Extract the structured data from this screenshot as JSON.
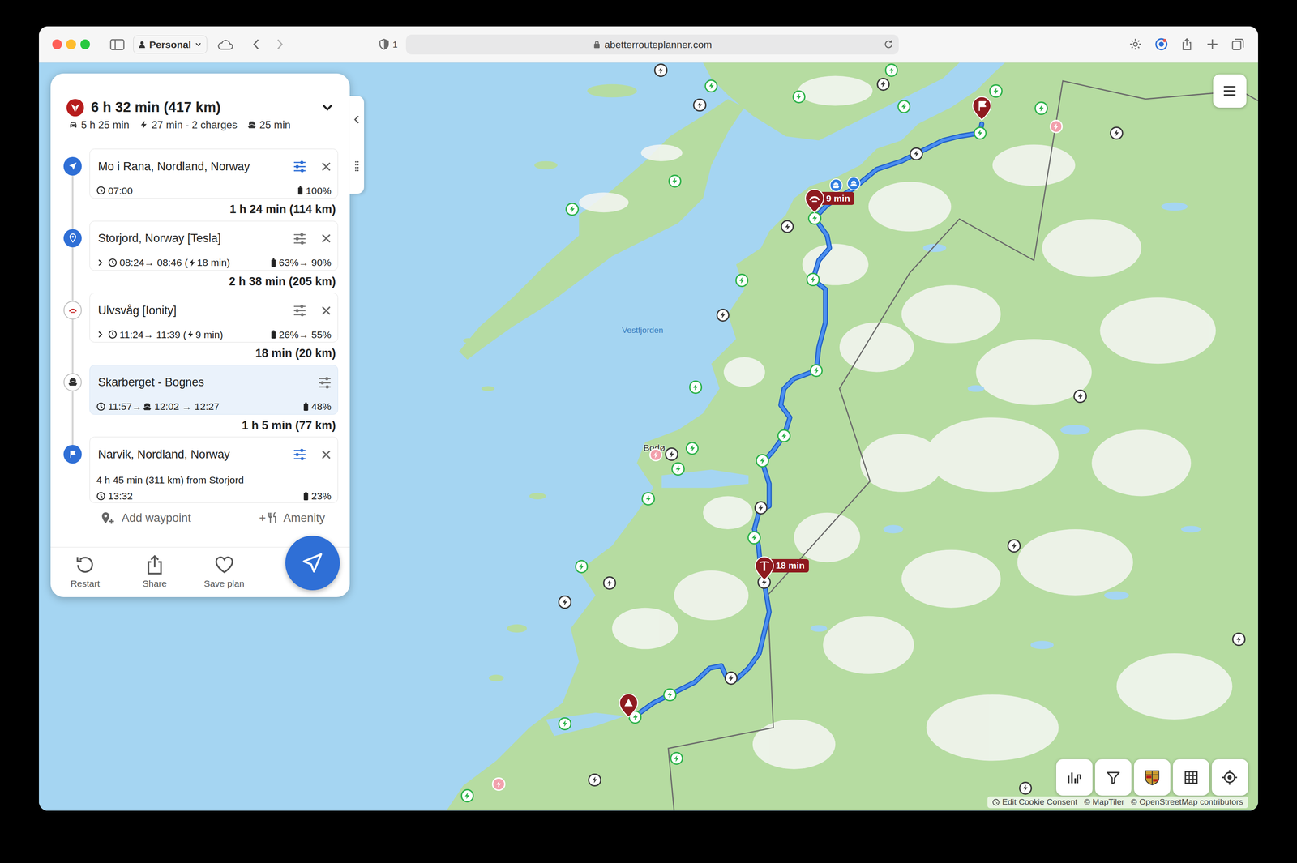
{
  "browser": {
    "profile": "Personal",
    "tracker_count": "1",
    "url": "abetterrouteplanner.com"
  },
  "summary": {
    "total": "6 h 32 min (417 km)",
    "drive": "5 h 25 min",
    "charging": "27 min - 2 charges",
    "ferry": "25 min",
    "expanded": false
  },
  "stops": [
    {
      "kind": "start",
      "name": "Mo i Rana, Nordland, Norway",
      "settings_set": true,
      "removable": true,
      "selected": false,
      "time": "07:00",
      "battery": "100%",
      "leg": "1 h 24 min (114 km)"
    },
    {
      "kind": "waypoint",
      "name": "Storjord, Norway [Tesla]",
      "settings_set": false,
      "removable": true,
      "selected": false,
      "expanded": false,
      "time": "08:24→ 08:46 (",
      "charge": "18 min)",
      "battery": "63%→ 90%",
      "leg": "2 h 38 min (205 km)"
    },
    {
      "kind": "charger",
      "name": "Ulvsvåg [Ionity]",
      "settings_set": false,
      "removable": true,
      "selected": false,
      "expanded": false,
      "time": "11:24→ 11:39 (",
      "charge": "9 min)",
      "battery": "26%→ 55%",
      "leg": "18 min (20 km)"
    },
    {
      "kind": "ferry",
      "name": "Skarberget - Bognes",
      "settings_set": false,
      "removable": false,
      "selected": true,
      "time": "11:57→",
      "crossing": "12:02 → 12:27",
      "battery": "48%",
      "leg": "1 h 5 min (77 km)"
    },
    {
      "kind": "destination",
      "name": "Narvik, Nordland, Norway",
      "settings_set": true,
      "removable": true,
      "selected": false,
      "note": "4 h 45 min (311 km) from Storjord",
      "time": "13:32",
      "battery": "23%"
    }
  ],
  "add_waypoint": "Add waypoint",
  "amenity_plus": "+",
  "amenity": "Amenity",
  "actions": [
    {
      "kind": "restart",
      "label": "Restart"
    },
    {
      "kind": "share",
      "label": "Share"
    },
    {
      "kind": "save",
      "label": "Save plan"
    }
  ],
  "map": {
    "labels": [
      {
        "text": "Vestfjorden",
        "kind": "water"
      },
      {
        "text": "Bodø",
        "kind": "town"
      }
    ],
    "pins": [
      {
        "kind": "start"
      },
      {
        "kind": "tesla",
        "label": "18 min"
      },
      {
        "kind": "ionity",
        "label": "9 min"
      },
      {
        "kind": "destination"
      }
    ],
    "chargers": [
      {
        "kind": "available"
      },
      {
        "kind": "available"
      },
      {
        "kind": "available"
      },
      {
        "kind": "available"
      },
      {
        "kind": "available"
      },
      {
        "kind": "available"
      },
      {
        "kind": "available"
      },
      {
        "kind": "available"
      },
      {
        "kind": "available"
      },
      {
        "kind": "available"
      },
      {
        "kind": "available"
      },
      {
        "kind": "available"
      },
      {
        "kind": "available"
      },
      {
        "kind": "available"
      },
      {
        "kind": "available"
      },
      {
        "kind": "available"
      },
      {
        "kind": "available"
      },
      {
        "kind": "available"
      },
      {
        "kind": "available"
      },
      {
        "kind": "available"
      },
      {
        "kind": "available"
      },
      {
        "kind": "available"
      },
      {
        "kind": "available"
      },
      {
        "kind": "available"
      },
      {
        "kind": "available"
      },
      {
        "kind": "available"
      },
      {
        "kind": "busy"
      },
      {
        "kind": "busy"
      },
      {
        "kind": "busy"
      },
      {
        "kind": "busy"
      },
      {
        "kind": "busy"
      },
      {
        "kind": "busy"
      },
      {
        "kind": "busy"
      },
      {
        "kind": "busy"
      },
      {
        "kind": "busy"
      },
      {
        "kind": "busy"
      },
      {
        "kind": "busy"
      },
      {
        "kind": "busy"
      },
      {
        "kind": "busy"
      },
      {
        "kind": "busy"
      },
      {
        "kind": "busy"
      },
      {
        "kind": "busy"
      },
      {
        "kind": "busy"
      },
      {
        "kind": "busy"
      },
      {
        "kind": "unavailable"
      },
      {
        "kind": "unavailable"
      },
      {
        "kind": "unavailable"
      },
      {
        "kind": "ferry"
      },
      {
        "kind": "ferry"
      }
    ],
    "attribution": [
      "Edit Cookie Consent",
      "© MapTiler",
      "© OpenStreetMap contributors"
    ]
  }
}
